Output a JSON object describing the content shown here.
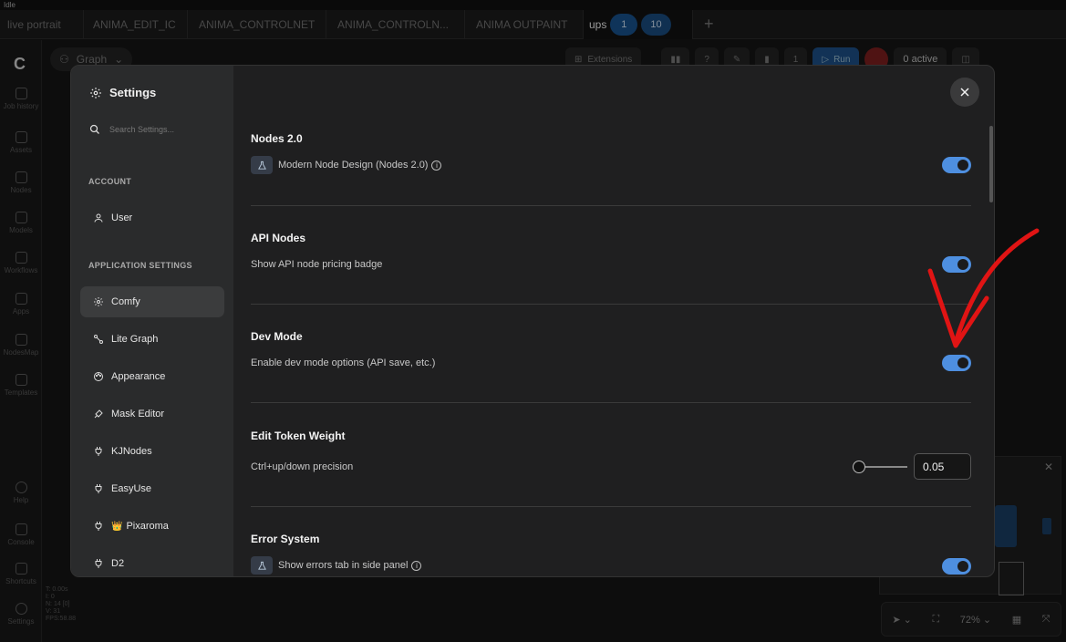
{
  "window": {
    "title": "Idle"
  },
  "tabs": [
    {
      "label": "live portrait"
    },
    {
      "label": "ANIMA_EDIT_IC"
    },
    {
      "label": "ANIMA_CONTROLNET"
    },
    {
      "label": "ANIMA_CONTROLN..."
    },
    {
      "label": "ANIMA OUTPAINT"
    },
    {
      "label": "ups"
    }
  ],
  "tab_pills": [
    "1",
    "10"
  ],
  "left_rail": [
    {
      "label": "Job history",
      "icon": "history-icon"
    },
    {
      "label": "Assets",
      "icon": "image-icon"
    },
    {
      "label": "Nodes",
      "icon": "nodes-icon"
    },
    {
      "label": "Models",
      "icon": "models-icon"
    },
    {
      "label": "Workflows",
      "icon": "workflow-icon"
    },
    {
      "label": "Apps",
      "icon": "apps-icon"
    },
    {
      "label": "NodesMap",
      "icon": "map-icon"
    },
    {
      "label": "Templates",
      "icon": "templates-icon"
    },
    {
      "label": "Help",
      "icon": "help-icon"
    },
    {
      "label": "Console",
      "icon": "console-icon"
    },
    {
      "label": "Shortcuts",
      "icon": "keyboard-icon"
    },
    {
      "label": "Settings",
      "icon": "gear-icon"
    }
  ],
  "graph_button": "Graph",
  "toolbar": {
    "extensions": "Extensions",
    "queue_count": "1",
    "run": "Run",
    "active": "0 active"
  },
  "status_lines": [
    "T: 0.00s",
    "I: 0",
    "N: 14 [0]",
    "V: 31",
    "FPS:58.88"
  ],
  "bottom_tools": {
    "zoom": "72%"
  },
  "settings": {
    "title": "Settings",
    "search_placeholder": "Search Settings...",
    "account_heading": "ACCOUNT",
    "app_heading": "APPLICATION SETTINGS",
    "nav": [
      {
        "label": "User",
        "icon": "user-icon"
      },
      {
        "label": "Comfy",
        "icon": "gear-icon",
        "active": true
      },
      {
        "label": "Lite Graph",
        "icon": "graph-icon"
      },
      {
        "label": "Appearance",
        "icon": "palette-icon"
      },
      {
        "label": "Mask Editor",
        "icon": "brush-icon"
      },
      {
        "label": "KJNodes",
        "icon": "plug-icon"
      },
      {
        "label": "EasyUse",
        "icon": "plug-icon"
      },
      {
        "label": "Pixaroma",
        "icon": "plug-icon",
        "badge": "👑"
      },
      {
        "label": "D2",
        "icon": "plug-icon"
      }
    ],
    "sections": [
      {
        "title": "Nodes 2.0",
        "label": "Modern Node Design (Nodes 2.0)",
        "beta": true,
        "info": true,
        "enabled": true
      },
      {
        "title": "API Nodes",
        "label": "Show API node pricing badge",
        "enabled": true
      },
      {
        "title": "Dev Mode",
        "label": "Enable dev mode options (API save, etc.)",
        "enabled": true
      },
      {
        "title": "Edit Token Weight",
        "label": "Ctrl+up/down precision",
        "value": "0.05"
      },
      {
        "title": "Error System",
        "label": "Show errors tab in side panel",
        "beta": true,
        "info": true,
        "enabled": true
      }
    ]
  },
  "annotation_color": "#e01414",
  "accent_color": "#4e8fe0"
}
